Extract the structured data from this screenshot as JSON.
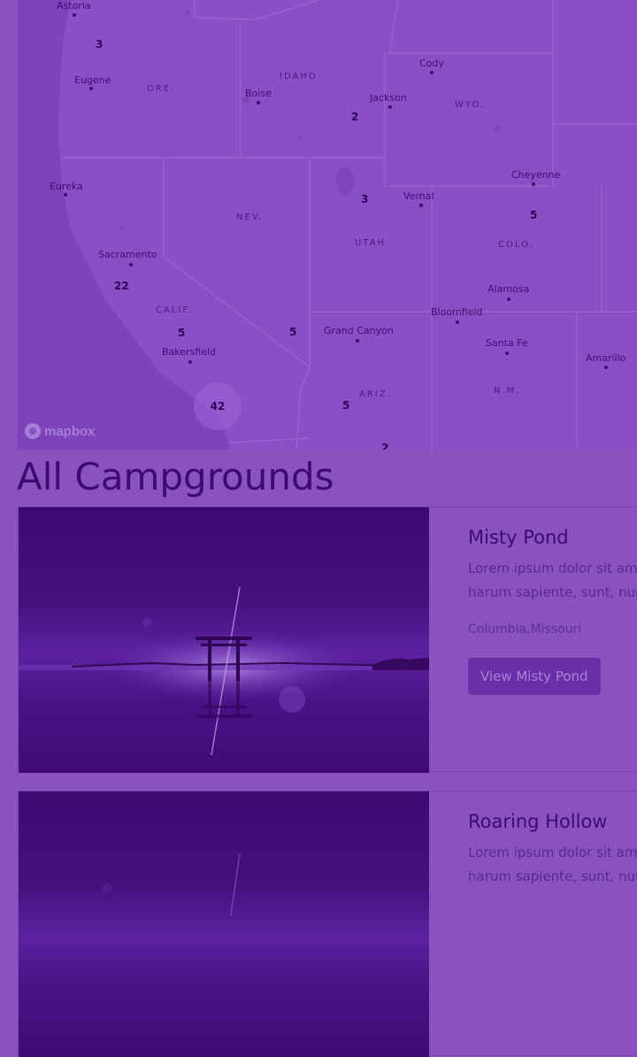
{
  "map": {
    "attribution": "mapbox",
    "cities": [
      {
        "name": "Astoria"
      },
      {
        "name": "Eugene"
      },
      {
        "name": "Boise"
      },
      {
        "name": "Cody"
      },
      {
        "name": "Jackson"
      },
      {
        "name": "Cheyenne"
      },
      {
        "name": "Eureka"
      },
      {
        "name": "Vernal"
      },
      {
        "name": "Sacramento"
      },
      {
        "name": "Alamosa"
      },
      {
        "name": "Bloomfield"
      },
      {
        "name": "Grand Canyon"
      },
      {
        "name": "Bakersfield"
      },
      {
        "name": "Santa Fe"
      },
      {
        "name": "Amarillo"
      }
    ],
    "states": [
      {
        "name": "IDAHO"
      },
      {
        "name": "ORE."
      },
      {
        "name": "WYO."
      },
      {
        "name": "NEV."
      },
      {
        "name": "UTAH"
      },
      {
        "name": "COLO."
      },
      {
        "name": "CALIF."
      },
      {
        "name": "ARIZ."
      },
      {
        "name": "N.M."
      }
    ],
    "clusters": [
      {
        "count": "3"
      },
      {
        "count": "2"
      },
      {
        "count": "3"
      },
      {
        "count": "5"
      },
      {
        "count": "22"
      },
      {
        "count": "5"
      },
      {
        "count": "5"
      },
      {
        "count": "42"
      },
      {
        "count": "5"
      },
      {
        "count": "2"
      }
    ]
  },
  "page": {
    "heading": "All Campgrounds"
  },
  "campgrounds": [
    {
      "title": "Misty Pond",
      "description_line1": "Lorem ipsum dolor sit amet",
      "description_line2": "harum sapiente, sunt, nulla",
      "location": "Columbia,Missouri",
      "button": "View Misty Pond"
    },
    {
      "title": "Roaring Hollow",
      "description_line1": "Lorem ipsum dolor sit amet",
      "description_line2": "harum sapiente, sunt, nulla"
    }
  ],
  "colors": {
    "background": "#8952bf",
    "heading": "#3d0b70",
    "button": "#6a2fa8",
    "photo_dark": "#3d0a72"
  }
}
